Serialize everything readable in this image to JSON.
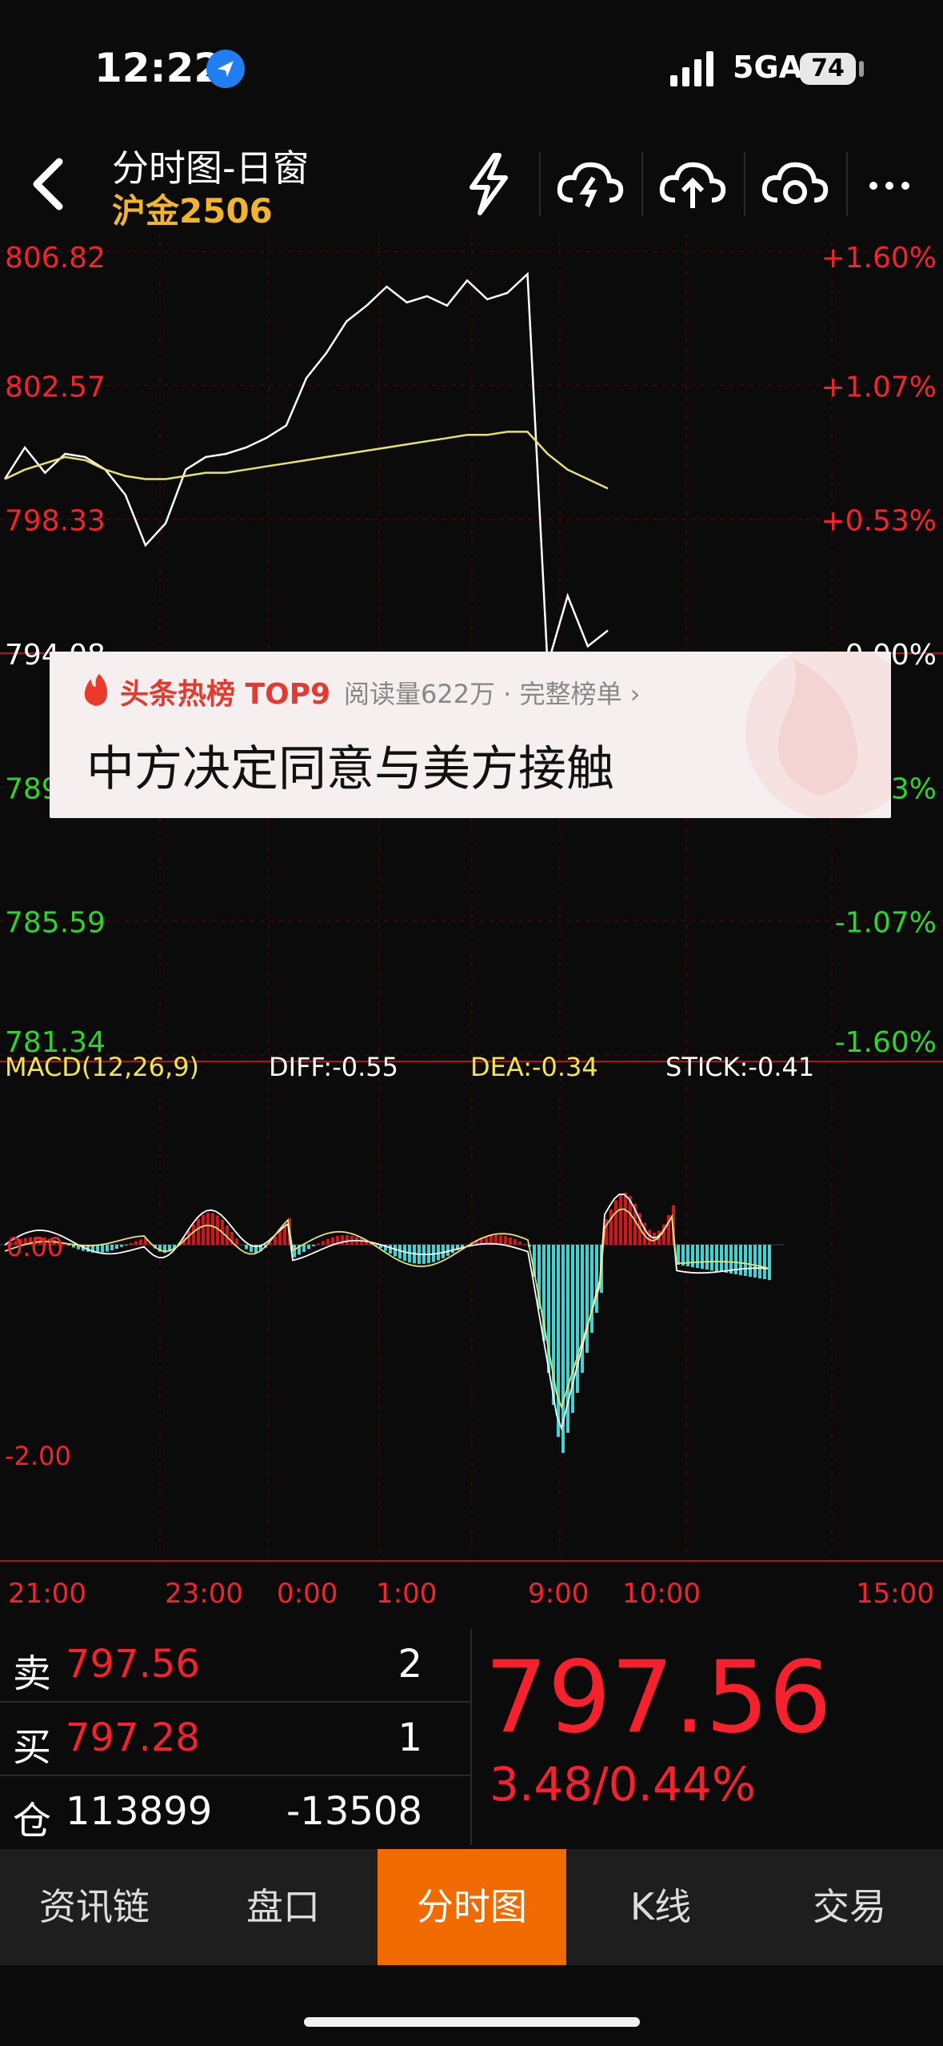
{
  "status_bar": {
    "time": "12:22",
    "network": "5GA",
    "battery": "74"
  },
  "header": {
    "title": "分时图-日窗",
    "subtitle": "沪金2506"
  },
  "colors": {
    "up": "#f5222d",
    "down": "#2bd62b",
    "accent": "#f06a00",
    "gold": "#f0b52b"
  },
  "price_axis": {
    "left": [
      "806.82",
      "802.57",
      "798.33",
      "794.08",
      "789.83",
      "785.59",
      "781.34"
    ],
    "right": [
      "+1.60%",
      "+1.07%",
      "+0.53%",
      "0.00%",
      "-0.53%",
      "-1.07%",
      "-1.60%"
    ]
  },
  "macd": {
    "label": "MACD(12,26,9)",
    "diff": "DIFF:-0.55",
    "dea": "DEA:-0.34",
    "stick": "STICK:-0.41",
    "zero_label": "0.00",
    "low_label": "-2.00"
  },
  "time_axis": [
    "21:00",
    "23:00",
    "0:00",
    "1:00",
    "9:00",
    "10:00",
    "15:00"
  ],
  "chart_data": {
    "type": "line",
    "title": "",
    "ylim": [
      781.34,
      806.82
    ],
    "series": [
      {
        "name": "",
        "values": [
          799.6,
          800.6,
          799.8,
          800.4,
          800.3,
          799.9,
          799.1,
          797.5,
          798.2,
          799.9,
          800.3,
          800.4,
          800.6,
          800.9,
          801.3,
          802.8,
          803.6,
          804.6,
          805.1,
          805.7,
          805.2,
          805.4,
          805.1,
          805.9,
          805.3,
          805.5,
          806.1,
          793.7,
          795.9,
          794.3,
          794.8
        ]
      },
      {
        "name": "",
        "values": [
          799.6,
          799.9,
          800.1,
          800.3,
          800.2,
          799.9,
          799.7,
          799.6,
          799.6,
          799.7,
          799.8,
          799.8,
          799.9,
          800.0,
          800.1,
          800.2,
          800.3,
          800.4,
          800.5,
          800.6,
          800.7,
          800.8,
          800.9,
          801.0,
          801.0,
          801.1,
          801.1,
          800.4,
          799.9,
          799.6,
          799.3
        ]
      }
    ]
  },
  "popup": {
    "tag": "头条热榜 TOP9",
    "meta": "阅读量622万 · 完整榜单 ›",
    "headline": "中方决定同意与美方接触"
  },
  "quote": {
    "sell_label": "卖",
    "sell_price": "797.56",
    "sell_qty": "2",
    "buy_label": "买",
    "buy_price": "797.28",
    "buy_qty": "1",
    "oi_label": "仓",
    "oi_value": "113899",
    "oi_change": "-13508",
    "last_price": "797.56",
    "change": "3.48/0.44%"
  },
  "tabs": [
    "资讯链",
    "盘口",
    "分时图",
    "K线",
    "交易"
  ],
  "active_tab": "分时图"
}
